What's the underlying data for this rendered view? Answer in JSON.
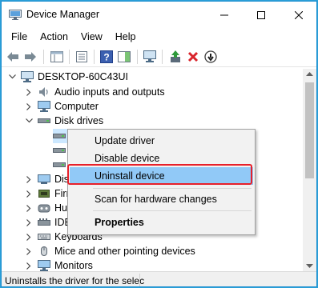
{
  "window": {
    "title": "Device Manager"
  },
  "menu": [
    "File",
    "Action",
    "View",
    "Help"
  ],
  "tree": {
    "root": "DESKTOP-60C43UI",
    "items": [
      {
        "label": "Audio inputs and outputs",
        "icon": "speaker-icon"
      },
      {
        "label": "Computer",
        "icon": "computer-icon"
      },
      {
        "label": "Disk drives",
        "icon": "disk-drive-icon"
      },
      {
        "label": "Dis",
        "icon": "display-adapter-icon"
      },
      {
        "label": "Firr",
        "icon": "firmware-icon"
      },
      {
        "label": "Hu",
        "icon": "hid-icon"
      },
      {
        "label": "IDE",
        "icon": "ide-controller-icon"
      },
      {
        "label": "Keyboards",
        "icon": "keyboard-icon"
      },
      {
        "label": "Mice and other pointing devices",
        "icon": "mouse-icon"
      },
      {
        "label": "Monitors",
        "icon": "monitor-icon"
      }
    ]
  },
  "context_menu": {
    "items": [
      "Update driver",
      "Disable device",
      "Uninstall device",
      "Scan for hardware changes",
      "Properties"
    ],
    "selected": "Uninstall device"
  },
  "status": {
    "text": "Uninstalls the driver for the selec"
  },
  "colors": {
    "highlight": "#91c9f7",
    "annotation_border": "#e8202a",
    "window_border": "#1e8fcf"
  }
}
